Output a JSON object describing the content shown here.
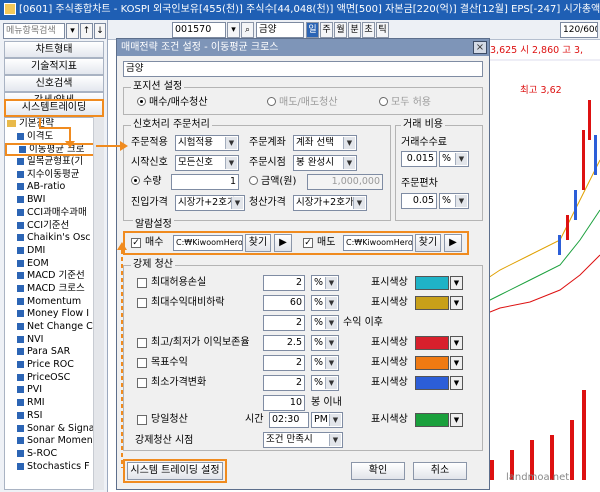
{
  "titlebar": {
    "text": "[0601] 주식종합차트 - KOSPI 외국인보유[455(천)] 주식수[44,048(천)] 액면[500] 자본금[220(억)] 결산[12월] EPS[-247] 시가총액[1,597(억"
  },
  "left_panel": {
    "search_placeholder": "메뉴항목검색",
    "search_icon_glyph": "▾",
    "up_glyph": "↑",
    "down_glyph": "↓",
    "menu": [
      "차트형태",
      "기술적지표",
      "신호검색",
      "강세/약세",
      "시스템트레이딩"
    ],
    "tree_root": "기본전략",
    "tree_items": [
      "이격도",
      "이동평균 크로",
      "일목균형표(기",
      "지수이동평균",
      "AB-ratio",
      "BWI",
      "CCI과매수과매",
      "CCI기준선",
      "Chaikin's Osc",
      "DMI",
      "EOM",
      "MACD 기준선",
      "MACD 크로스",
      "Momentum",
      "Money Flow I",
      "Net Change C",
      "NVI",
      "Para SAR",
      "Price ROC",
      "PriceOSC",
      "PVI",
      "RMI",
      "RSI",
      "Sonar & Signa",
      "Sonar Momen",
      "S-ROC",
      "Stochastics F"
    ]
  },
  "toolbar": {
    "code": "001570",
    "name": "금양",
    "period_buttons": [
      "일",
      "주",
      "월",
      "분",
      "초",
      "틱"
    ],
    "count": "120/600"
  },
  "chart": {
    "price_line": "3,625  시  2,860  고  3,",
    "high_label": "최고 3,62",
    "watermark": "landmoa.net"
  },
  "dialog": {
    "title": "매매전략 조건 설정 - 이동평균 크로스",
    "close_glyph": "×",
    "stock_name": "금양",
    "position": {
      "label": "포지션 설정",
      "options": [
        "매수/매수청산",
        "매도/매도청산",
        "모두 허용"
      ],
      "selected": 0
    },
    "order": {
      "label": "신호처리 주문처리",
      "order_price_label": "주문적용",
      "order_price_value": "시험적용",
      "account_label": "주문계좌",
      "account_value": "계좌 선택",
      "start_signal_label": "시작신호",
      "start_signal_value": "모든신호",
      "order_time_label": "주문시점",
      "order_time_value": "봉 완성시",
      "qty_label": "수량",
      "qty_value": "1",
      "amount_label": "금액(원)",
      "amount_value": "1,000,000",
      "entry_label": "진입가격",
      "entry_value": "시장가+2호가",
      "exit_label": "청산가격",
      "exit_value": "시장가+2호가"
    },
    "cost": {
      "label": "거래 비용",
      "fee_label": "거래수수료",
      "fee_value": "0.015",
      "fee_unit": "%",
      "slippage_label": "주문편차",
      "slippage_value": "0.05",
      "slippage_unit": "%"
    },
    "alarm": {
      "label": "알람설정",
      "buy_label": "매수",
      "buy_path": "C:₩KiwoomHero4₩s",
      "sell_label": "매도",
      "sell_path": "C:₩KiwoomHero4₩s",
      "browse_label": "찾기",
      "play_glyph": "▶",
      "buy_checked": true,
      "sell_checked": true
    },
    "forced": {
      "label": "강제 청산",
      "rows": [
        {
          "label": "최대허용손실",
          "value": "2",
          "unit": "%",
          "color_label": "표시색상",
          "color": "#1fb3c7"
        },
        {
          "label": "최대수익대비하락",
          "value": "60",
          "unit": "%",
          "color_label": "표시색상",
          "color": "#c8a019"
        },
        {
          "label": "",
          "value": "2",
          "unit": "%",
          "suffix": "수익 이후"
        },
        {
          "label": "최고/최저가 이익보존율",
          "value": "2.5",
          "unit": "%",
          "color_label": "표시색상",
          "color": "#d8202c"
        },
        {
          "label": "목표수익",
          "value": "2",
          "unit": "%",
          "color_label": "표시색상",
          "color": "#f07a12"
        },
        {
          "label": "최소가격변화",
          "value": "2",
          "unit": "%",
          "color_label": "표시색상",
          "color": "#2c5ed8"
        },
        {
          "label": "",
          "value": "10",
          "suffix": "봉 이내"
        }
      ],
      "sameday_label": "당일청산",
      "time_label": "시간",
      "time_value": "02:30",
      "ampm_value": "PM",
      "sameday_color_label": "표시색상",
      "sameday_color": "#1aa03c",
      "timing_label": "강제청산 시점",
      "timing_value": "조건 만족시"
    },
    "system_settings_label": "시스템 트레이딩 설정",
    "ok_label": "확인",
    "cancel_label": "취소"
  },
  "colors": {
    "highlight": "#f08b1f",
    "titlebar": "#1f5fb4",
    "dialog_title": "#7e95b8"
  }
}
